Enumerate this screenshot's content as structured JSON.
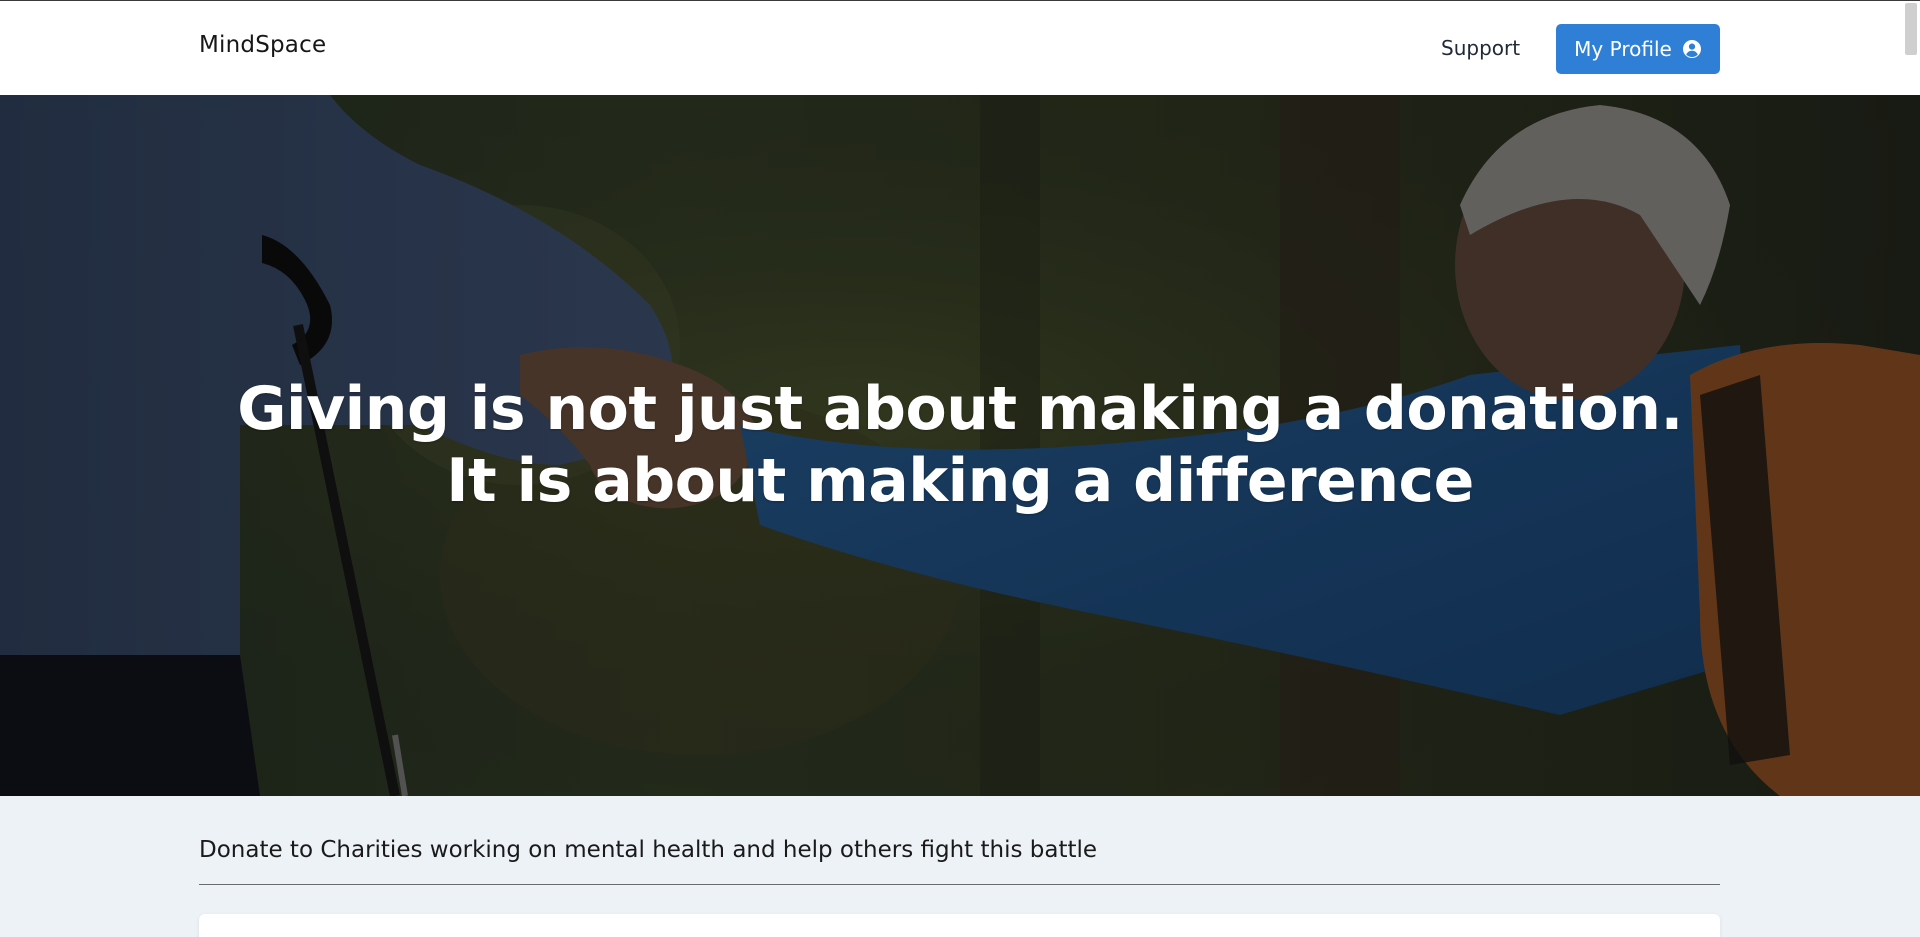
{
  "header": {
    "brand": "MindSpace",
    "nav_support": "Support",
    "profile_button": "My Profile",
    "profile_icon": "user-circle-icon",
    "accent_color": "#2f7fd6"
  },
  "hero": {
    "title_line1": "Giving is not just about making a donation.",
    "title_line2": "It is about making a difference"
  },
  "section": {
    "heading": "Donate to Charities working on mental health and help others fight this battle"
  }
}
